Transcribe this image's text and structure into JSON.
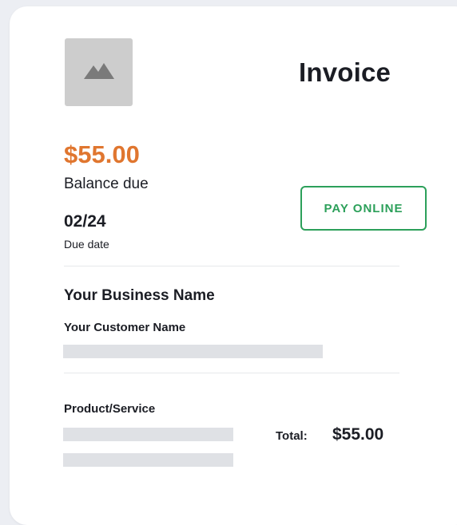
{
  "invoice": {
    "title": "Invoice",
    "logo_icon": "image-placeholder-icon",
    "balance_amount": "$55.00",
    "balance_label": "Balance due",
    "due_date": "02/24",
    "due_date_label": "Due date",
    "pay_button_label": "PAY ONLINE",
    "business_name": "Your Business Name",
    "customer_name": "Your Customer Name",
    "product_label": "Product/Service",
    "total_label": "Total:",
    "total_value": "$55.00"
  },
  "colors": {
    "accent_orange": "#e0762f",
    "accent_green": "#2ca05a",
    "text_dark": "#1b1d24",
    "placeholder_gray": "#dfe1e5",
    "logo_gray": "#cdcdcd",
    "background": "#eceef3"
  }
}
